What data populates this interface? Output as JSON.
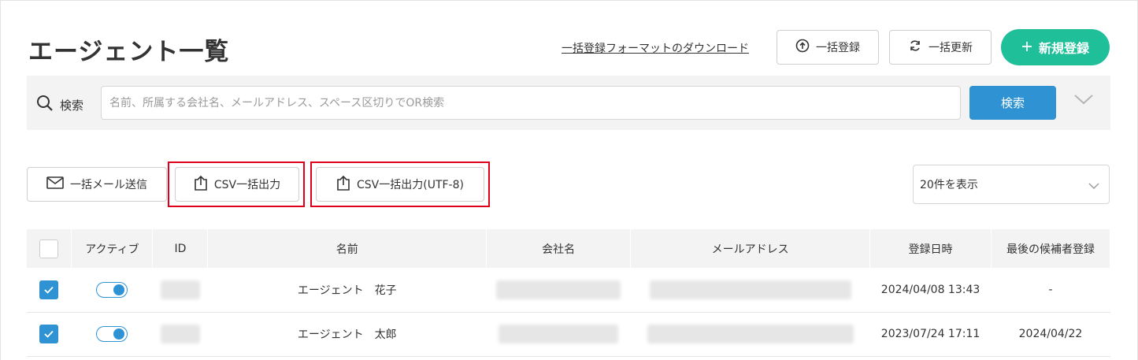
{
  "page": {
    "title": "エージェント一覧"
  },
  "header": {
    "format_link": "一括登録フォーマットのダウンロード",
    "bulk_register": "一括登録",
    "bulk_update": "一括更新",
    "new_register": "新規登録"
  },
  "search": {
    "label": "検索",
    "placeholder": "名前、所属する会社名、メールアドレス、スペース区切りでOR検索",
    "button": "検索"
  },
  "actions": {
    "bulk_mail": "一括メール送信",
    "csv_export": "CSV一括出力",
    "csv_export_utf8": "CSV一括出力(UTF-8)"
  },
  "per_page": {
    "selected": "20件を表示"
  },
  "table": {
    "columns": [
      "アクティブ",
      "ID",
      "名前",
      "会社名",
      "メールアドレス",
      "登録日時",
      "最後の候補者登録"
    ],
    "rows": [
      {
        "checked": true,
        "active": true,
        "name": "エージェント　花子",
        "registered_at": "2024/04/08 13:43",
        "last_candidate": "-"
      },
      {
        "checked": true,
        "active": true,
        "name": "エージェント　太郎",
        "registered_at": "2023/07/24 17:11",
        "last_candidate": "2024/04/22"
      }
    ]
  },
  "colors": {
    "accent": "#2f93d3",
    "new_button": "#1fbf9a",
    "highlight": "#e0001b"
  },
  "icons": [
    "upload-circle-icon",
    "refresh-icon",
    "plus-icon",
    "search-icon",
    "chevron-down-icon",
    "mail-icon",
    "export-icon",
    "check-icon"
  ]
}
